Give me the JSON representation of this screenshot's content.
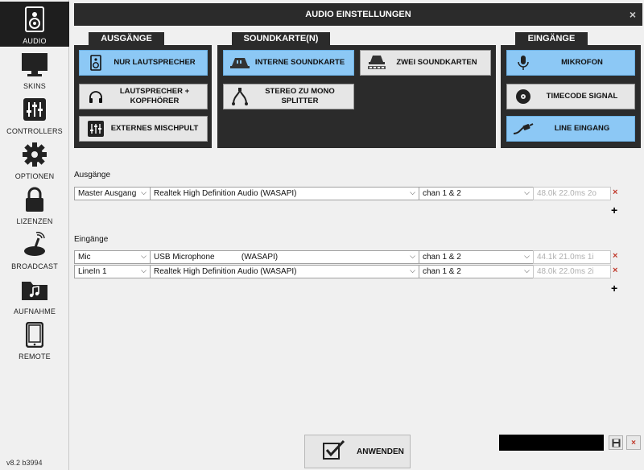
{
  "sidebar": {
    "items": [
      {
        "label": "AUDIO",
        "icon": "speaker-icon"
      },
      {
        "label": "SKINS",
        "icon": "monitor-icon"
      },
      {
        "label": "CONTROLLERS",
        "icon": "sliders-icon"
      },
      {
        "label": "OPTIONEN",
        "icon": "gear-icon"
      },
      {
        "label": "LIZENZEN",
        "icon": "lock-icon"
      },
      {
        "label": "BROADCAST",
        "icon": "broadcast-icon"
      },
      {
        "label": "AUFNAHME",
        "icon": "folder-music-icon"
      },
      {
        "label": "REMOTE",
        "icon": "tablet-icon"
      }
    ],
    "version": "v8.2 b3994"
  },
  "window": {
    "title": "AUDIO EINSTELLUNGEN",
    "close": "×"
  },
  "outputs_panel": {
    "title": "AUSGÄNGE",
    "buttons": [
      {
        "label": "NUR LAUTSPRECHER",
        "selected": true
      },
      {
        "label": "LAUTSPRECHER + KOPFHÖRER",
        "selected": false
      },
      {
        "label": "EXTERNES MISCHPULT",
        "selected": false
      }
    ]
  },
  "soundcard_panel": {
    "title": "SOUNDKARTE(N)",
    "buttons": [
      {
        "label": "INTERNE SOUNDKARTE",
        "selected": true
      },
      {
        "label": "ZWEI SOUNDKARTEN",
        "selected": false
      },
      {
        "label": "STEREO ZU MONO SPLITTER",
        "selected": false
      }
    ]
  },
  "inputs_panel": {
    "title": "EINGÄNGE",
    "buttons": [
      {
        "label": "MIKROFON",
        "selected": true
      },
      {
        "label": "TIMECODE SIGNAL",
        "selected": false
      },
      {
        "label": "LINE EINGANG",
        "selected": true
      }
    ]
  },
  "outputs_section": {
    "label": "Ausgänge",
    "rows": [
      {
        "channel": "Master Ausgang",
        "device": "Realtek High Definition Audio (WASAPI)",
        "chan": "chan 1 & 2",
        "info": "48.0k 22.0ms 2o"
      }
    ]
  },
  "inputs_section": {
    "label": "Eingänge",
    "rows": [
      {
        "channel": "Mic",
        "device": "USB Microphone            (WASAPI)",
        "chan": "chan 1 & 2",
        "info": "44.1k 21.0ms 1i"
      },
      {
        "channel": "LineIn 1",
        "device": "Realtek High Definition Audio (WASAPI)",
        "chan": "chan 1 & 2",
        "info": "48.0k 22.0ms 2i"
      }
    ]
  },
  "symbols": {
    "delete": "×",
    "add": "+",
    "dropdown": "⌵"
  },
  "apply": {
    "label": "ANWENDEN"
  },
  "colors": {
    "selected": "#8cc8f5",
    "panel": "#2b2b2b",
    "delete": "#c0392b"
  }
}
